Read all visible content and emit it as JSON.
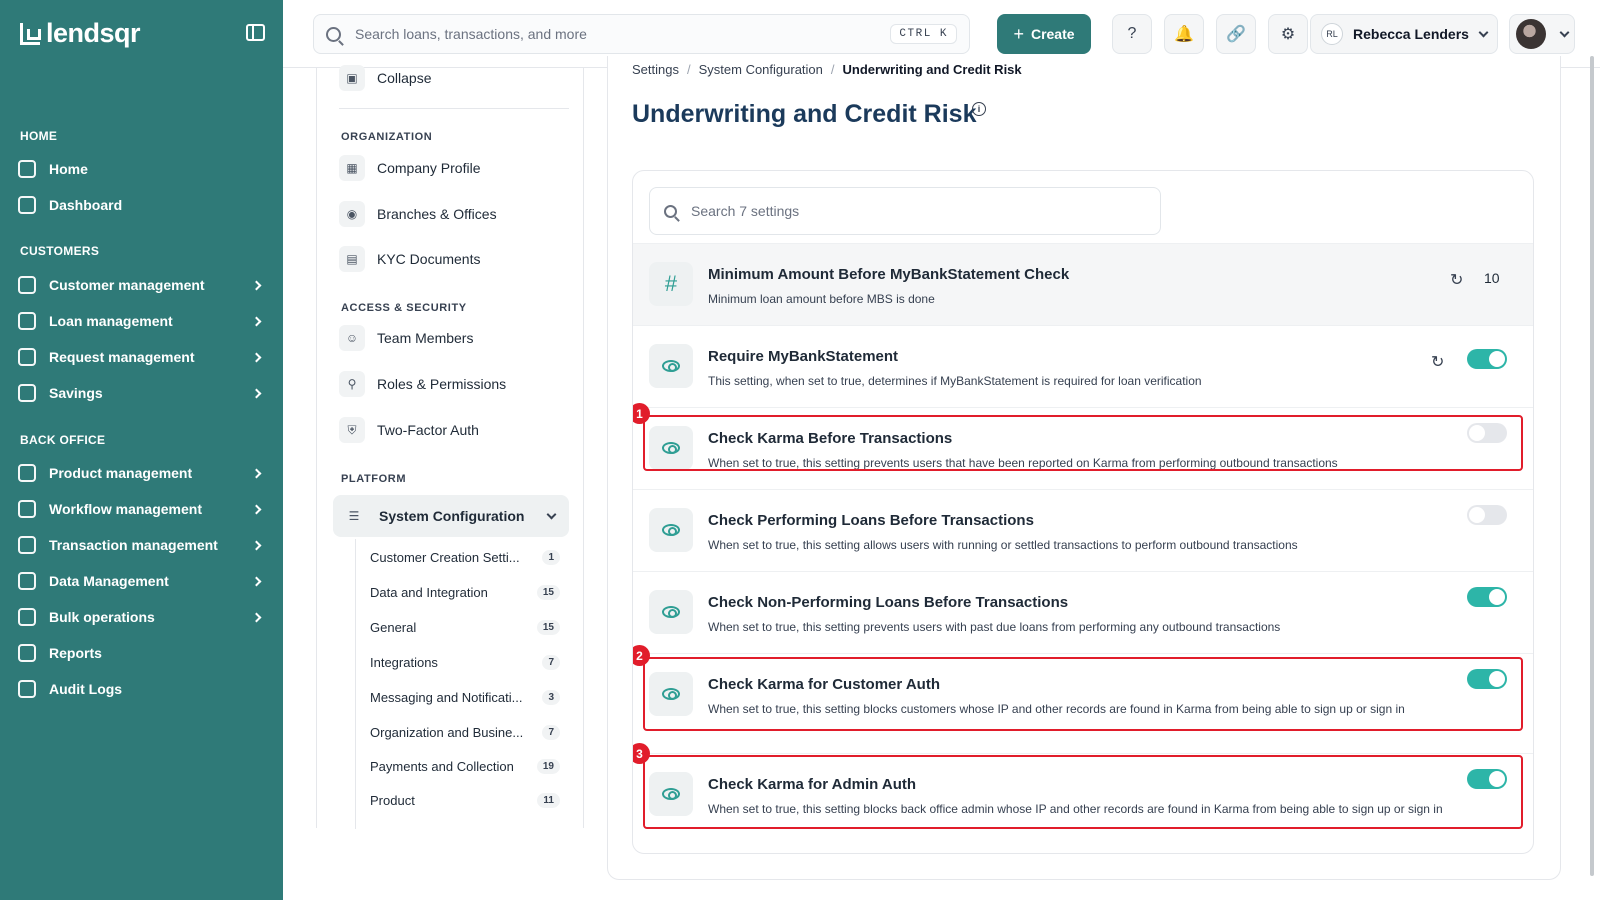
{
  "brand": {
    "name": "lendsqr"
  },
  "sidebar": {
    "sections": [
      {
        "title": "HOME",
        "items": [
          {
            "label": "Home",
            "icon": "home-icon"
          },
          {
            "label": "Dashboard",
            "icon": "dashboard-icon"
          }
        ]
      },
      {
        "title": "CUSTOMERS",
        "items": [
          {
            "label": "Customer management",
            "icon": "users-icon"
          },
          {
            "label": "Loan management",
            "icon": "loan-icon"
          },
          {
            "label": "Request management",
            "icon": "inbox-icon"
          },
          {
            "label": "Savings",
            "icon": "savings-icon"
          }
        ]
      },
      {
        "title": "BACK OFFICE",
        "items": [
          {
            "label": "Product management",
            "icon": "box-icon"
          },
          {
            "label": "Workflow management",
            "icon": "workflow-icon"
          },
          {
            "label": "Transaction management",
            "icon": "transfer-icon"
          },
          {
            "label": "Data Management",
            "icon": "chart-icon"
          },
          {
            "label": "Bulk operations",
            "icon": "inbox-icon"
          },
          {
            "label": "Reports",
            "icon": "bar-chart-icon"
          },
          {
            "label": "Audit Logs",
            "icon": "clipboard-icon"
          }
        ]
      }
    ]
  },
  "topbar": {
    "search_placeholder": "Search loans, transactions, and more",
    "shortcut": "CTRL K",
    "create_label": "Create",
    "user_initials": "RL",
    "user_name": "Rebecca Lenders"
  },
  "settings_nav": {
    "collapse_label": "Collapse",
    "organization_title": "ORGANIZATION",
    "organization_items": [
      "Company Profile",
      "Branches & Offices",
      "KYC Documents"
    ],
    "security_title": "ACCESS & SECURITY",
    "security_items": [
      "Team Members",
      "Roles & Permissions",
      "Two-Factor Auth"
    ],
    "platform_title": "PLATFORM",
    "system_config_label": "System Configuration",
    "sub_items": [
      {
        "label": "Customer Creation Setti...",
        "count": "1"
      },
      {
        "label": "Data and Integration",
        "count": "15"
      },
      {
        "label": "General",
        "count": "15"
      },
      {
        "label": "Integrations",
        "count": "7"
      },
      {
        "label": "Messaging and Notificati...",
        "count": "3"
      },
      {
        "label": "Organization and Busine...",
        "count": "7"
      },
      {
        "label": "Payments and Collection",
        "count": "19"
      },
      {
        "label": "Product",
        "count": "11"
      }
    ]
  },
  "main": {
    "breadcrumb": [
      "Settings",
      "System Configuration",
      "Underwriting and Credit Risk"
    ],
    "title": "Underwriting and Credit Risk",
    "search_placeholder": "Search 7 settings",
    "settings": [
      {
        "title": "Minimum Amount Before MyBankStatement Check",
        "desc": "Minimum loan amount before MBS is done",
        "type": "number",
        "value": "10"
      },
      {
        "title": "Require MyBankStatement",
        "desc": "This setting, when set to true, determines if MyBankStatement is required for loan verification",
        "type": "toggle",
        "on": true
      },
      {
        "title": "Check Karma Before Transactions",
        "desc": "When set to true, this setting prevents users that have been reported on Karma from performing outbound transactions",
        "type": "toggle",
        "on": false
      },
      {
        "title": "Check Performing Loans Before Transactions",
        "desc": "When set to true, this setting allows users with running or settled transactions to perform outbound transactions",
        "type": "toggle",
        "on": false
      },
      {
        "title": "Check Non-Performing Loans Before Transactions",
        "desc": "When set to true, this setting prevents users with past due loans from performing any outbound transactions",
        "type": "toggle",
        "on": true
      },
      {
        "title": "Check Karma for Customer Auth",
        "desc": "When set to true, this setting blocks customers whose IP and other records are found in Karma from being able to sign up or sign in",
        "type": "toggle",
        "on": true
      },
      {
        "title": "Check Karma for Admin Auth",
        "desc": "When set to true, this setting blocks back office admin whose IP and other records are found in Karma from being able to sign up or sign in",
        "type": "toggle",
        "on": true
      }
    ],
    "annotations": [
      "1",
      "2",
      "3"
    ]
  },
  "colors": {
    "sidebar": "#2f7a78",
    "accent": "#2db5a8",
    "title": "#1b3a5b",
    "annotation": "#e11d2b"
  }
}
